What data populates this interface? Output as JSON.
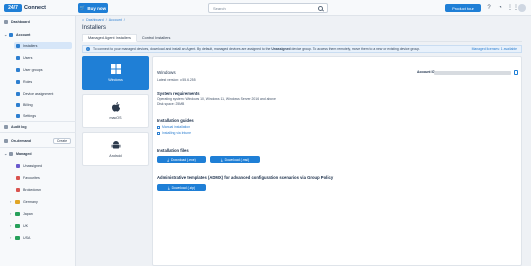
{
  "topbar": {
    "logo_badge": "24/7",
    "logo_text": "Connect",
    "buy_label": "Buy now",
    "search_placeholder": "Search",
    "product_tour_label": "Product tour"
  },
  "sidebar": {
    "dashboard": "Dashboard",
    "account": "Account",
    "installers": "Installers",
    "users": "Users",
    "user_groups": "User groups",
    "roles": "Roles",
    "device_assignment": "Device assignment",
    "billing": "Billing",
    "settings": "Settings",
    "audit_log": "Audit log",
    "on_demand": "On-demand",
    "create_label": "Create",
    "managed": "Managed",
    "unassigned": "Unassigned",
    "favourites": "Favourites",
    "brokedown": "Brokedown",
    "germany": "Germany",
    "japan": "Japan",
    "uk": "UK",
    "usa": "USA"
  },
  "main": {
    "breadcrumb": [
      "Dashboard",
      "/",
      "Account",
      "/"
    ],
    "title": "Installers",
    "tabs": [
      "Managed Agent Installers",
      "Control Installers"
    ],
    "info_text_before": "To connect to your managed devices, download and install an Agent. By default, managed devices are assigned to the ",
    "info_bold": "Unassigned",
    "info_text_after": " device group. To access them remotely, move them to a new or existing device group.",
    "managed_licenses": "Managed licenses: 1 available"
  },
  "os_cards": [
    {
      "label": "Windows"
    },
    {
      "label": "macOS"
    },
    {
      "label": "Android"
    }
  ],
  "detail": {
    "os_name": "Windows",
    "latest_version": "Latest version: v.55.6.255",
    "account_id_label": "Account ID:",
    "requirements_title": "System requirements",
    "requirements_os": "Operating system: Windows 10, Windows 11, Windows Server 2016 and above",
    "requirements_disk": "Disk space: 25MB",
    "guides_title": "Installation guides",
    "guide_manual": "Manual installation",
    "guide_intune": "Installing via Intune",
    "files_title": "Installation files",
    "download_exe": "Download (.exe)",
    "download_msi": "Download (.msi)",
    "admx_title": "Administrative templates (ADMX) for advanced configuration scenarios via Group Policy",
    "download_zip": "Download (.zip)"
  },
  "colors": {
    "accent": "#1f7fd6",
    "germany": "#e0a526",
    "japan": "#26a05a",
    "uk": "#26a05a",
    "usa": "#26a05a"
  }
}
